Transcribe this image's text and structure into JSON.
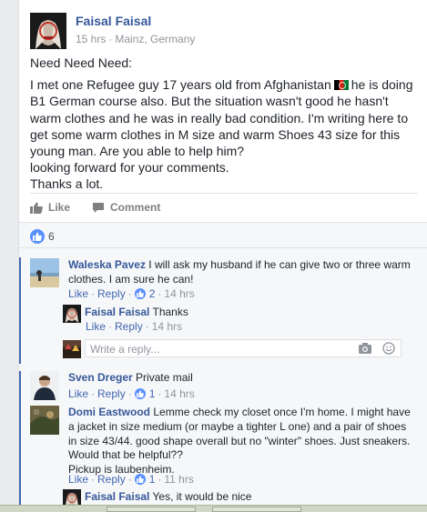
{
  "post": {
    "author": "Faisal Faisal",
    "time": "15 hrs",
    "location": "Mainz, Germany",
    "meta_sep": "·",
    "paragraph1": "Need Need Need:",
    "paragraph2_a": "I met one Refugee guy 17 years old from Afghanistan",
    "paragraph2_b": "he is doing B1 German course also. But the situation wasn't good he hasn't warm clothes and he was in really bad condition. I'm writing here to get some warm clothes in M size and warm Shoes 43 size for this young man. Are you able to help him?",
    "paragraph3": "looking forward for your comments.",
    "paragraph4": "Thanks a lot.",
    "flag_icon": "afghanistan-flag-icon"
  },
  "actions": {
    "like_label": "Like",
    "comment_label": "Comment"
  },
  "reactions": {
    "count": "6"
  },
  "links": {
    "like": "Like",
    "reply": "Reply",
    "sep": "·"
  },
  "comments": [
    {
      "author": "Waleska Pavez",
      "text": "I will ask my husband if he can give two or three warm clothes. I am sure he can!",
      "likes": "2",
      "time": "14 hrs"
    },
    {
      "author": "Faisal Faisal",
      "text": "Thanks",
      "time": "14 hrs"
    },
    {
      "author": "Sven Dreger",
      "text": "Private mail",
      "likes": "1",
      "time": "14 hrs"
    },
    {
      "author": "Domi Eastwood",
      "text": "Lemme check my closet once I'm home. I might have a jacket in size medium (or maybe a tighter L one) and a pair of shoes in size 43/44. good shape overall but no \"winter\" shoes. Just sneakers. Would that be helpful??",
      "text2": "Pickup is laubenheim.",
      "likes": "1",
      "time": "11 hrs"
    },
    {
      "author": "Faisal Faisal",
      "text": "Yes, it would be nice"
    }
  ],
  "reply_box": {
    "placeholder": "Write a reply..."
  },
  "colors": {
    "link_blue": "#365899",
    "like_blue": "#5890ff",
    "thread_bar": "#4267b2"
  }
}
